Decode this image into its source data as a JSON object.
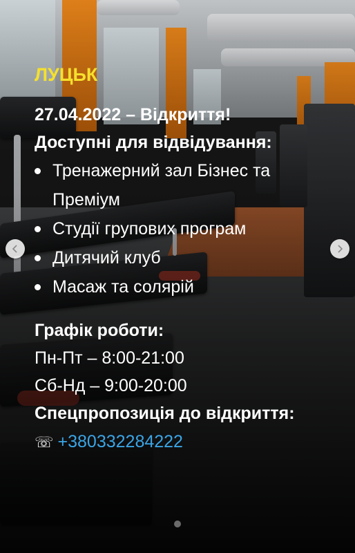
{
  "slide": {
    "city": "ЛУЦЬК",
    "opening": "27.04.2022 – Відкриття!",
    "available_heading": "Доступні для відвідування:",
    "available_items": [
      "Тренажерний зал Бізнес та Преміум",
      "Студії групових програм",
      "Дитячий клуб",
      "Масаж та солярій"
    ],
    "schedule_heading": "Графік роботи:",
    "schedule": [
      "Пн-Пт – 8:00-21:00",
      "Сб-Нд – 9:00-20:00"
    ],
    "special_offer": "Спецпропозиція до відкриття:",
    "phone_icon": "☏",
    "phone": "+380332284222"
  },
  "carousel": {
    "prev_icon": "chevron-left-icon",
    "next_icon": "chevron-right-icon",
    "dot_count": 1
  },
  "colors": {
    "city": "#f5e02d",
    "phone_link": "#3aa5e6",
    "accent_orange": "#f08a1c"
  }
}
